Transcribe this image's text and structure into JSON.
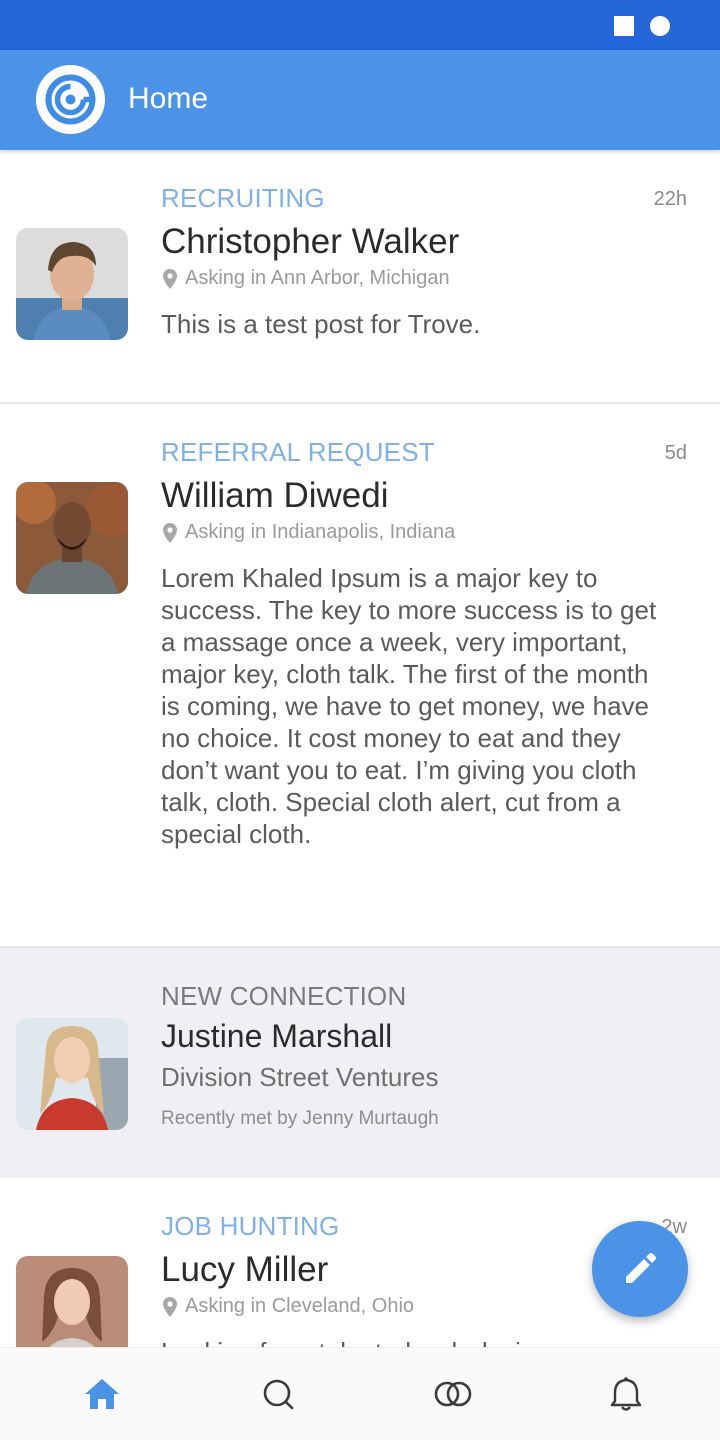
{
  "app": {
    "title": "Home",
    "primary_color": "#4a93e6",
    "status_bar_color": "#2367d8",
    "logo_icon": "trove-logo-icon"
  },
  "feed": [
    {
      "category": "RECRUITING",
      "category_color": "#7fb1e6",
      "time": "22h",
      "name": "Christopher Walker",
      "location": "Asking in Ann Arbor, Michigan",
      "body": "This is a test post for Trove."
    },
    {
      "category": "REFERRAL REQUEST",
      "category_color": "#7fb1e6",
      "time": "5d",
      "name": "William Diwedi",
      "location": "Asking in Indianapolis, Indiana",
      "body": "Lorem Khaled Ipsum is a major key to success. The key to more success is to get a massage once a week, very important, major key, cloth talk. The first of the month is coming, we have to get money, we have no choice. It cost money to eat and they don’t want you to eat. I’m giving you cloth talk, cloth. Special cloth alert, cut from a special cloth."
    },
    {
      "category": "NEW CONNECTION",
      "category_color": "#7a7a7e",
      "name": "Justine Marshall",
      "company": "Division Street Ventures",
      "met_by": "Recently met by Jenny Murtaugh"
    },
    {
      "category": "JOB HUNTING",
      "category_color": "#7fb1e6",
      "time": "2w",
      "name": "Lucy Miller",
      "location": "Asking in Cleveland, Ohio",
      "body": "Looking for a talented web designer"
    }
  ],
  "fab": {
    "icon": "pencil-icon"
  },
  "bottom_nav": [
    {
      "icon": "home-icon",
      "active": true
    },
    {
      "icon": "search-icon",
      "active": false
    },
    {
      "icon": "connections-icon",
      "active": false
    },
    {
      "icon": "bell-icon",
      "active": false
    }
  ]
}
